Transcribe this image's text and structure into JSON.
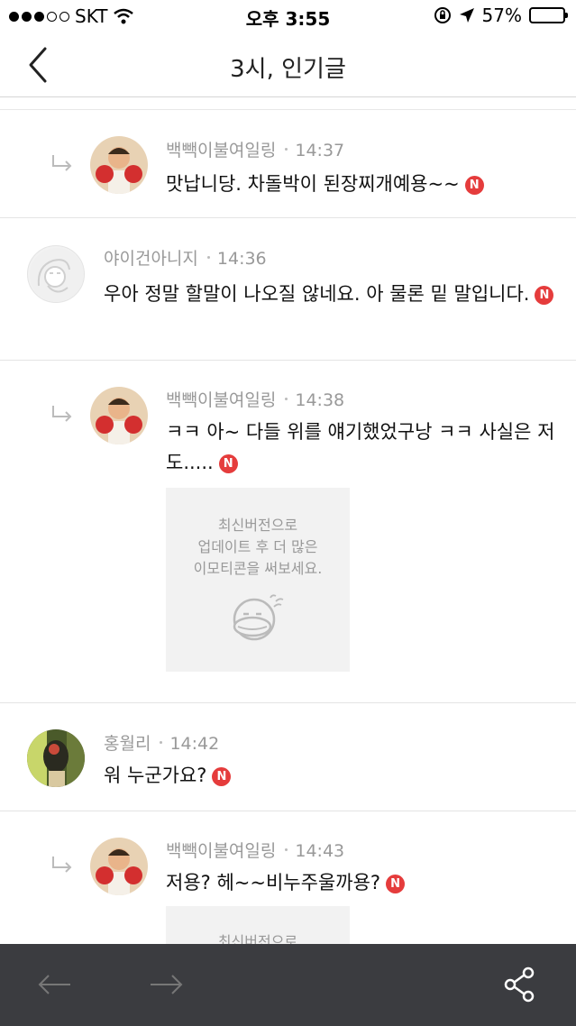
{
  "status_bar": {
    "carrier": "SKT",
    "time": "오후 3:55",
    "battery": "57%",
    "battery_level": 0.57
  },
  "header": {
    "title": "3시, 인기글",
    "back_icon": "chevron-left-icon"
  },
  "comments": [
    {
      "author": "백빽이불여일링",
      "time": "14:37",
      "text": "맛납니당. 차돌박이 된장찌개예용~~",
      "is_reply": true,
      "avatar": "boxer-avatar",
      "new_badge": "N"
    },
    {
      "author": "야이건아니지",
      "time": "14:36",
      "text": "우아 정말 할말이 나오질 않네요. 아 물론 밑 말입니다.",
      "is_reply": false,
      "avatar": "default-face-avatar",
      "new_badge": "N"
    },
    {
      "author": "백빽이불여일링",
      "time": "14:38",
      "text": "ㅋㅋ 아~ 다들 위를 얘기했었구낭 ㅋㅋ 사실은 저도.....",
      "is_reply": true,
      "avatar": "boxer-avatar",
      "new_badge": "N",
      "emoticon_notice": [
        "최신버전으로",
        "업데이트 후 더 많은",
        "이모티콘을 써보세요."
      ]
    },
    {
      "author": "홍월리",
      "time": "14:42",
      "text": "워 누군가요?",
      "is_reply": false,
      "avatar": "photo-avatar",
      "new_badge": "N"
    },
    {
      "author": "백빽이불여일링",
      "time": "14:43",
      "text": "저용? 헤~~비누주울까용?",
      "is_reply": true,
      "avatar": "boxer-avatar",
      "new_badge": "N",
      "emoticon_notice_partial": "최신버전으로"
    }
  ],
  "bottom_bar": {
    "back_icon": "arrow-left-icon",
    "forward_icon": "arrow-right-icon",
    "share_icon": "share-icon"
  },
  "colors": {
    "badge": "#e53c3c",
    "bottom_bar": "#3b3c40",
    "meta_text": "#999999"
  }
}
